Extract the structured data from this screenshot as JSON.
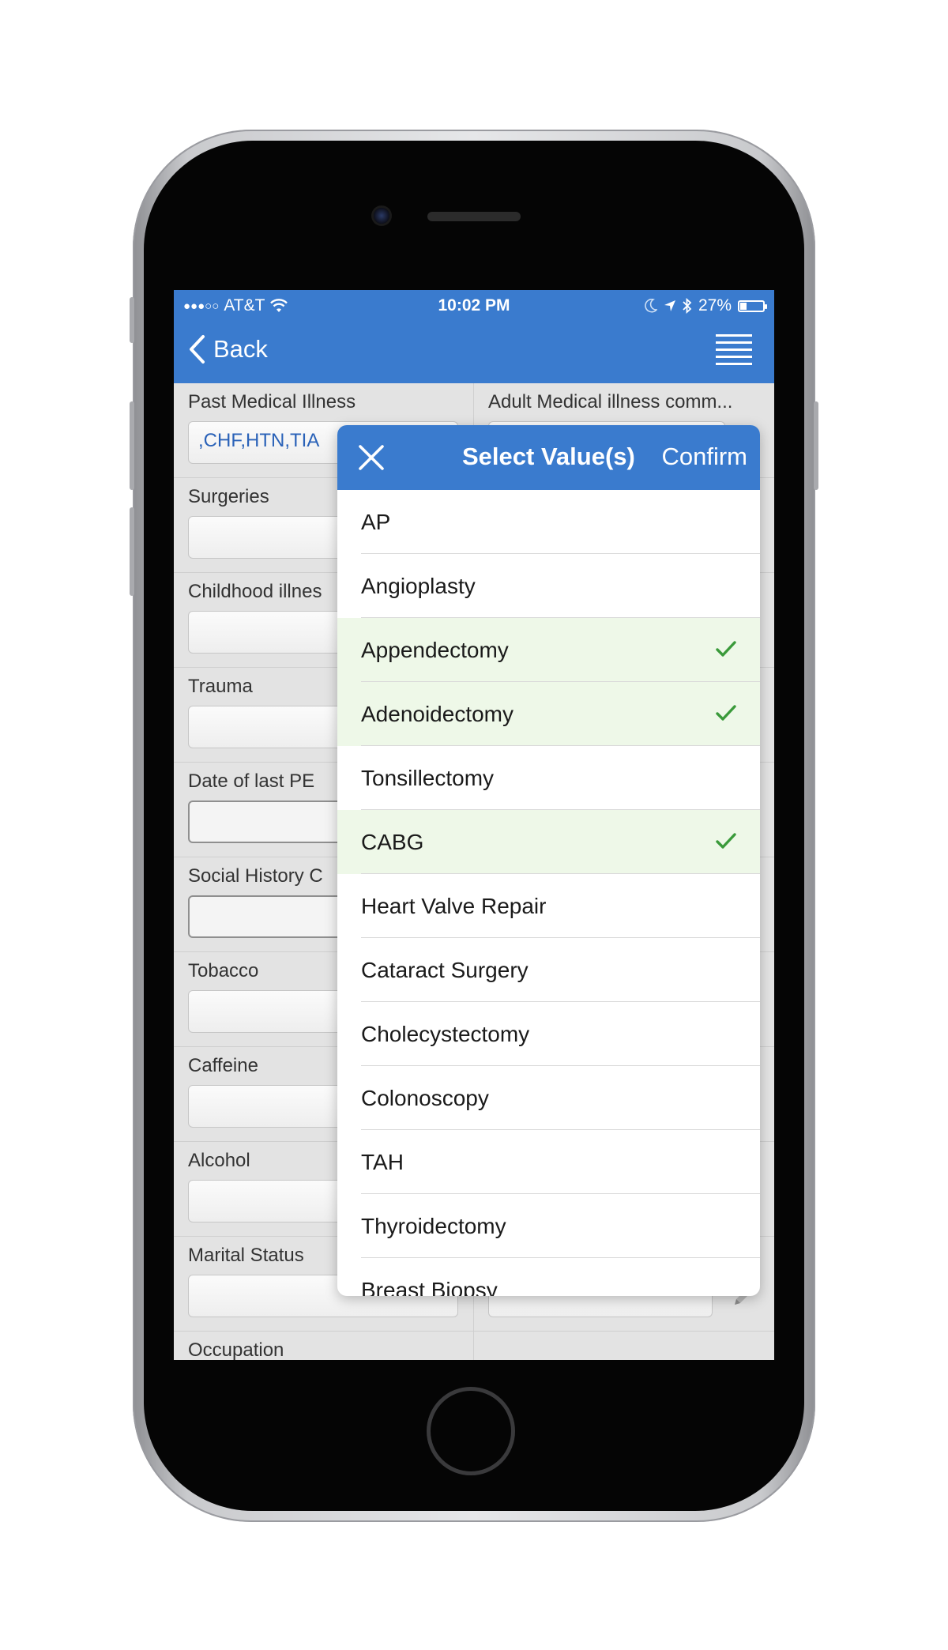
{
  "status_bar": {
    "signal_dots": "●●●○○",
    "carrier": "AT&T",
    "time": "10:02 PM",
    "battery_percent": "27%",
    "battery_level": 0.27
  },
  "nav": {
    "back_label": "Back",
    "menu_icon": "hamburger-menu-icon"
  },
  "form": {
    "fields": [
      {
        "label": "Past Medical Illness",
        "value": ",CHF,HTN,TIA"
      },
      {
        "label": "Adult Medical illness comm...",
        "value": ""
      },
      {
        "label": "Surgeries",
        "value": ""
      },
      {
        "label": "Childhood illnes",
        "value": ""
      },
      {
        "label": "Trauma",
        "value": ""
      },
      {
        "label": "Date of last PE",
        "value": ""
      },
      {
        "label": "Social History C",
        "value": ""
      },
      {
        "label": "Tobacco",
        "value": ""
      },
      {
        "label": "Caffeine",
        "value": ""
      },
      {
        "label": "Alcohol",
        "value": ""
      },
      {
        "label": "Marital Status",
        "value": ""
      },
      {
        "label": "Occupation",
        "value": ""
      }
    ]
  },
  "picker": {
    "title": "Select Value(s)",
    "confirm_label": "Confirm",
    "options": [
      {
        "label": "AP",
        "selected": false
      },
      {
        "label": "Angioplasty",
        "selected": false
      },
      {
        "label": "Appendectomy",
        "selected": true
      },
      {
        "label": "Adenoidectomy",
        "selected": true
      },
      {
        "label": "Tonsillectomy",
        "selected": false
      },
      {
        "label": "CABG",
        "selected": true
      },
      {
        "label": "Heart Valve Repair",
        "selected": false
      },
      {
        "label": "Cataract Surgery",
        "selected": false
      },
      {
        "label": "Cholecystectomy",
        "selected": false
      },
      {
        "label": "Colonoscopy",
        "selected": false
      },
      {
        "label": "TAH",
        "selected": false
      },
      {
        "label": "Thyroidectomy",
        "selected": false
      },
      {
        "label": "Breast Biopsy",
        "selected": false
      }
    ]
  },
  "colors": {
    "primary": "#3a7bce",
    "selected_row": "#eef8e8",
    "check": "#3a9a3a",
    "value_text": "#2a62b8"
  }
}
